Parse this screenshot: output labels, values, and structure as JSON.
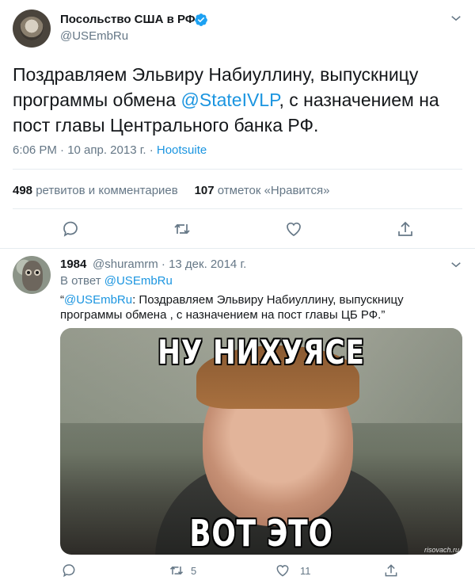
{
  "main_tweet": {
    "account_name": "Посольство США в РФ",
    "handle": "@USEmbRu",
    "text_before": "Поздравляем Эльвиру Набиуллину, выпускницу программы обмена ",
    "mention": "@StateIVLP",
    "text_after": ", с назначением на пост главы Центрального банка РФ.",
    "time": "6:06 PM · 10 апр. 2013 г. · ",
    "source": "Hootsuite",
    "retweets_count": "498",
    "retweets_label": "ретвитов и комментариев",
    "likes_count": "107",
    "likes_label": "отметок «Нравится»"
  },
  "reply_tweet": {
    "name": "1984",
    "handle_date": "@shuramrm · 13 дек. 2014 г.",
    "reply_prefix": "В ответ ",
    "reply_mention": "@USEmbRu",
    "quote_open": "“",
    "quote_mention": "@USEmbRu",
    "quote_text": ": Поздравляем Эльвиру Набиуллину, выпускницу программы обмена , с назначением на пост главы ЦБ РФ.”",
    "meme_top": "НУ НИХУЯСЕ",
    "meme_bottom": "ВОТ ЭТО ПОВОРОТ",
    "meme_watermark": "risovach.ru",
    "retweets": "5",
    "likes": "11"
  },
  "icons": [
    "chevron-down-icon",
    "verified-icon",
    "reply-icon",
    "retweet-icon",
    "like-icon",
    "share-icon"
  ],
  "colors": {
    "accent": "#1b95e0",
    "text": "#14171a",
    "secondary": "#657786",
    "divider": "#e6ecf0"
  }
}
